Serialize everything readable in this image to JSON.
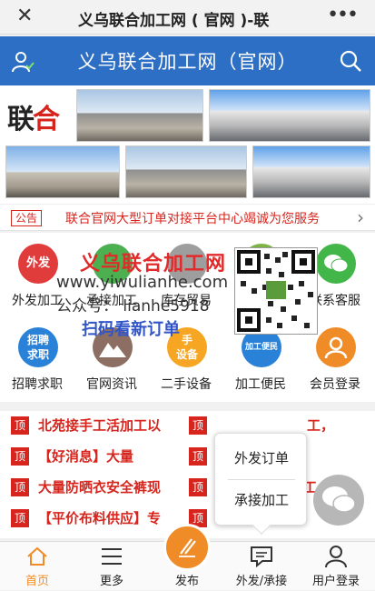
{
  "window": {
    "title": "义乌联合加工网 ( 官网 )-联",
    "close_icon": "close-icon",
    "more_icon": "more-dots-icon"
  },
  "header": {
    "title": "义乌联合加工网（官网）",
    "color": "#2d6fc4"
  },
  "banner": {
    "logo_text_black": "联",
    "logo_text_red": "合"
  },
  "notice": {
    "tag": "公告",
    "text": "联合官网大型订单对接平台中心竭诚为您服务"
  },
  "grid": {
    "items": [
      {
        "label": "外发加工",
        "icon_text": "外发",
        "color": "#e03c3c"
      },
      {
        "label": "承接加工",
        "icon_text": "",
        "color": "#4caf50"
      },
      {
        "label": "库存贸易",
        "icon_text": "",
        "color": "#9e9e9e"
      },
      {
        "label": "",
        "icon_text": "",
        "color": "#7cb342"
      },
      {
        "label": "联系客服",
        "icon_text": "",
        "color": "#43b649"
      },
      {
        "label": "招聘求职",
        "icon_text": "招聘\n求职",
        "color": "#2a82d8"
      },
      {
        "label": "官网资讯",
        "icon_text": "",
        "color": "#8d6e63"
      },
      {
        "label": "二手设备",
        "icon_text": "手\n设备",
        "color": "#f6a623"
      },
      {
        "label": "加工便民",
        "icon_text": "加工便民",
        "color": "#2a82d8"
      },
      {
        "label": "会员登录",
        "icon_text": "",
        "color": "#f08c27"
      }
    ]
  },
  "watermark": {
    "line1": "义乌联合加工网",
    "line2": "www.yiwulianhe.com",
    "line3": "公众号： lianhe5918",
    "line4": "扫码看新订单"
  },
  "news": {
    "left": [
      "北苑接手工活加工以",
      "【好消息】大量",
      "大量防晒衣安全裤现",
      "【平价布料供应】专"
    ],
    "right": [
      "工，",
      "",
      "工",
      "专"
    ],
    "badge": "顶"
  },
  "popup": {
    "item1": "外发订单",
    "item2": "承接加工"
  },
  "bottom_nav": {
    "items": [
      {
        "label": "首页"
      },
      {
        "label": "更多"
      },
      {
        "label": "发布"
      },
      {
        "label": "外发/承接"
      },
      {
        "label": "用户登录"
      }
    ],
    "accent": "#f08c27"
  }
}
